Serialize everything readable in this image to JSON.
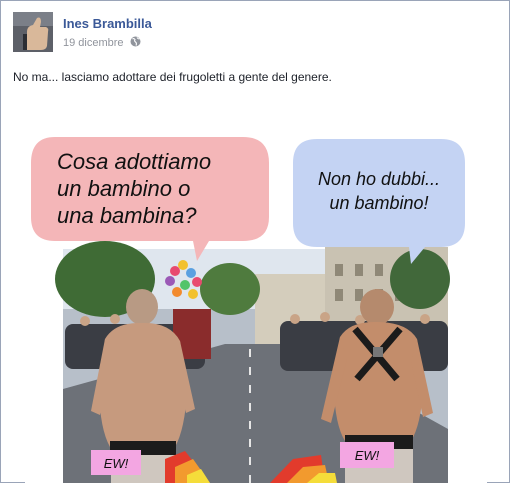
{
  "post": {
    "author": "Ines Brambilla",
    "date": "19 dicembre",
    "privacy_icon": "globe-icon",
    "text": "No ma... lasciamo adottare dei frugoletti a gente del genere."
  },
  "meme": {
    "bubble_left": {
      "line1": "Cosa adottiamo",
      "line2": "un bambino o",
      "line3": "una bambina?",
      "color": "#f4b6b8"
    },
    "bubble_right": {
      "line1": "Non ho dubbi...",
      "line2": "un bambino!",
      "color": "#c4d3f3"
    },
    "tag_left": "EW!",
    "tag_right": "EW!",
    "tag_color": "#f3a6e2"
  },
  "colors": {
    "link": "#3b5998",
    "text": "#1d2129",
    "meta": "#90949c",
    "border": "#9aa4b8"
  }
}
